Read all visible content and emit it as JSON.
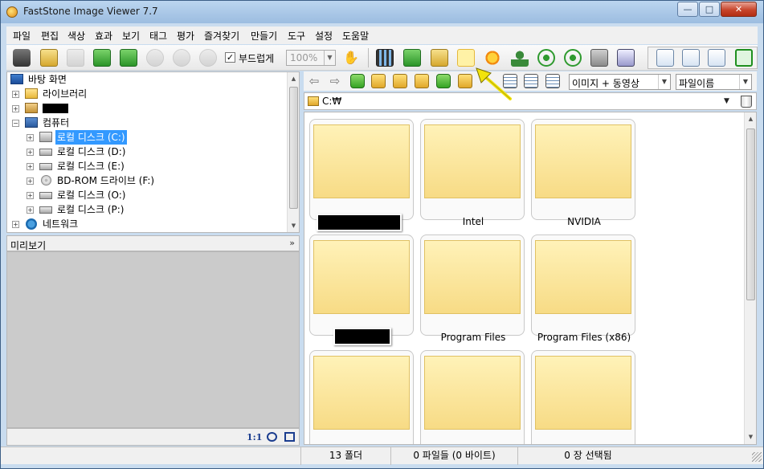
{
  "window": {
    "title": "FastStone Image Viewer 7.7",
    "minimize": "—",
    "maximize": "□",
    "close": "✕"
  },
  "menu": [
    "파일",
    "편집",
    "색상",
    "효과",
    "보기",
    "태그",
    "평가",
    "즐겨찾기",
    "만들기",
    "도구",
    "설정",
    "도움말"
  ],
  "toolbar": {
    "smooth_label": "부드럽게",
    "smooth_checked": "✓",
    "zoom_value": "100%",
    "combo_arrow": "▼"
  },
  "tree": {
    "desktop": "바탕 화면",
    "library": "라이브러리",
    "computer": "컴퓨터",
    "drive_c": "로컬 디스크 (C:)",
    "drive_d": "로컬 디스크 (D:)",
    "drive_e": "로컬 디스크 (E:)",
    "drive_f": "BD-ROM 드라이브 (F:)",
    "drive_o": "로컬 디스크 (O:)",
    "drive_p": "로컬 디스크 (P:)",
    "network": "네트워크",
    "plus": "+",
    "minus": "−"
  },
  "preview": {
    "title": "미리보기",
    "collapse": "»",
    "ratio": "1:1"
  },
  "browser": {
    "filter": "이미지 + 동영상",
    "sort": "파일이름",
    "path": "C:₩",
    "folders": [
      {
        "label": ""
      },
      {
        "label": "Intel"
      },
      {
        "label": "NVIDIA"
      },
      {
        "label": ""
      },
      {
        "label": "Program Files"
      },
      {
        "label": "Program Files (x86)"
      },
      {
        "label": ""
      },
      {
        "label": ""
      },
      {
        "label": ""
      }
    ]
  },
  "status": {
    "folders": "13 폴더",
    "files": "0 파일들 (0 바이트)",
    "selected": "0 장 선택됨"
  },
  "colors": {
    "accent_selected": "#3399ff",
    "pointer": "#f2e30c",
    "folder_fill": "#f7db85"
  }
}
